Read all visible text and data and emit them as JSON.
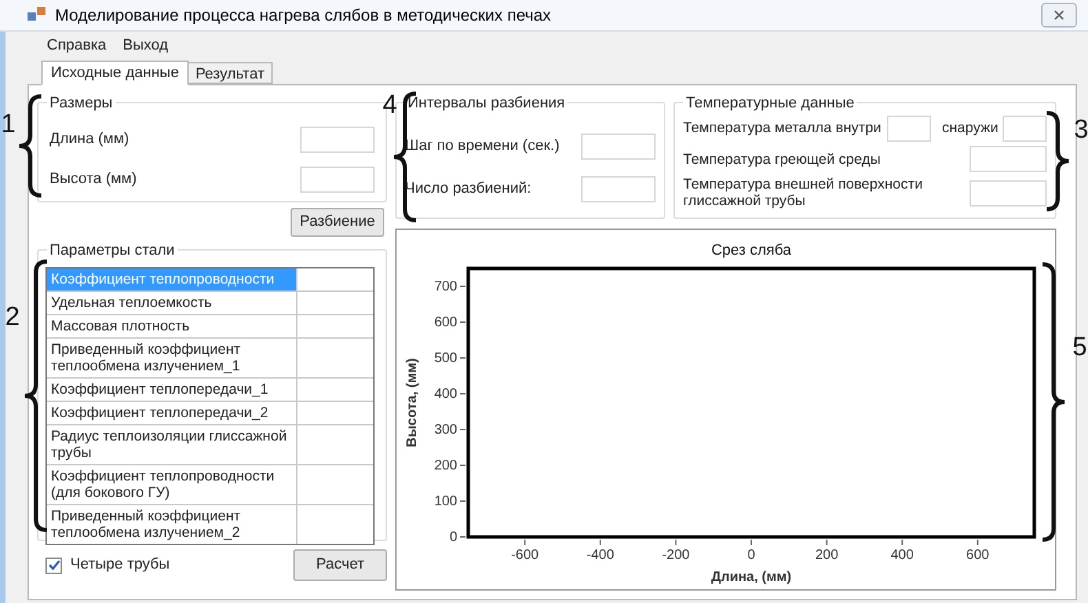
{
  "window": {
    "title": "Моделирование процесса нагрева слябов в методических печах"
  },
  "menu": [
    {
      "label": "Справка"
    },
    {
      "label": "Выход"
    }
  ],
  "tabs": [
    {
      "label": "Исходные данные",
      "selected": true
    },
    {
      "label": "Результат",
      "selected": false
    }
  ],
  "sizes": {
    "title": "Размеры",
    "fields": [
      {
        "label": "Длина (мм)"
      },
      {
        "label": "Высота (мм)"
      }
    ],
    "button": "Разбиение"
  },
  "steel": {
    "title": "Параметры стали",
    "rows": [
      {
        "label": "Коэффициент теплопроводности",
        "selected": true
      },
      {
        "label": "Удельная теплоемкость",
        "selected": false
      },
      {
        "label": "Массовая плотность",
        "selected": false
      },
      {
        "label": "Приведенный коэффициент теплообмена излучением_1",
        "selected": false
      },
      {
        "label": "Коэффициент теплопередачи_1",
        "selected": false
      },
      {
        "label": "Коэффициент теплопередачи_2",
        "selected": false
      },
      {
        "label": "Радиус теплоизоляции глиссажной трубы",
        "selected": false
      },
      {
        "label": "Коэффициент теплопроводности (для бокового ГУ)",
        "selected": false
      },
      {
        "label": "Приведенный коэффициент теплообмена излучением_2",
        "selected": false
      }
    ]
  },
  "four_pipes": {
    "label": "Четыре трубы",
    "checked": true
  },
  "calc_button": "Расчет",
  "intervals": {
    "title": "Интервалы разбиения",
    "fields": [
      {
        "label": "Шаг по времени (сек.)"
      },
      {
        "label": "Число разбиений:"
      }
    ]
  },
  "temperature": {
    "title": "Температурные данные",
    "rows": [
      {
        "fields": [
          {
            "label": "Температура металла внутри"
          },
          {
            "label": "снаружи"
          }
        ]
      },
      {
        "fields": [
          {
            "label": "Температура греющей среды"
          }
        ]
      },
      {
        "fields": [
          {
            "label": "Температура внешней поверхности глиссажной трубы"
          }
        ]
      }
    ]
  },
  "chart": {
    "chart_data": {
      "type": "line",
      "title": "Срез сляба",
      "xlabel": "Длина, (мм)",
      "ylabel": "Высота, (мм)",
      "xlim": [
        -750,
        750
      ],
      "ylim": [
        0,
        750
      ],
      "xticks": [
        -600,
        -400,
        -200,
        0,
        200,
        400,
        600
      ],
      "yticks": [
        0,
        100,
        200,
        300,
        400,
        500,
        600,
        700
      ]
    }
  },
  "annotations": [
    {
      "label": "1"
    },
    {
      "label": "2"
    },
    {
      "label": "3"
    },
    {
      "label": "4"
    },
    {
      "label": "5"
    }
  ]
}
